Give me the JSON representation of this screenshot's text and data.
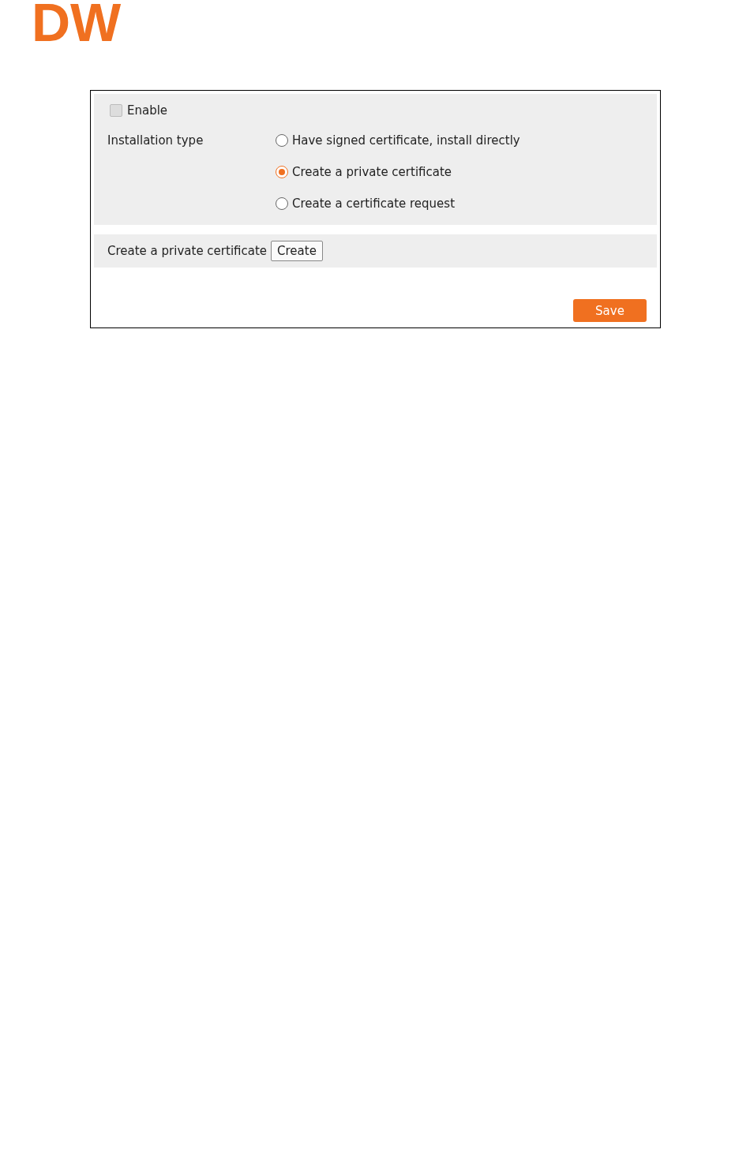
{
  "logo": {
    "text": "DW"
  },
  "enable": {
    "label": "Enable",
    "checked": false,
    "disabled": true
  },
  "installation_type": {
    "label": "Installation type",
    "options": [
      {
        "label": "Have signed certificate, install directly",
        "selected": false
      },
      {
        "label": "Create a private certificate",
        "selected": true
      },
      {
        "label": "Create a certificate request",
        "selected": false
      }
    ]
  },
  "private_certificate": {
    "label": "Create a private certificate",
    "button": "Create"
  },
  "save_button": "Save"
}
